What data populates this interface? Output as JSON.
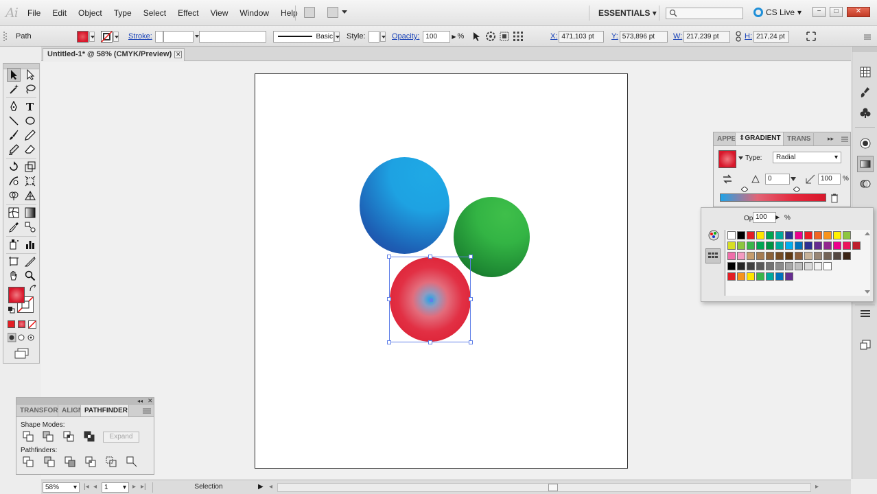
{
  "app": {
    "logo": "Ai"
  },
  "menu": [
    "File",
    "Edit",
    "Object",
    "Type",
    "Select",
    "Effect",
    "View",
    "Window",
    "Help"
  ],
  "header": {
    "workspace": "ESSENTIALS",
    "search_placeholder": "",
    "cs_live": "CS Live",
    "window_minimize": "−",
    "window_restore": "□",
    "window_close": "✕"
  },
  "control_bar": {
    "selection_type": "Path",
    "stroke_label": "Stroke:",
    "brush_label": "Basic",
    "style_label": "Style:",
    "opacity_label": "Opacity:",
    "opacity_value": "100",
    "opacity_unit": "%",
    "x_label": "X:",
    "x_value": "471,103 pt",
    "y_label": "Y:",
    "y_value": "573,896 pt",
    "w_label": "W:",
    "w_value": "217,239 pt",
    "h_label": "H:",
    "h_value": "217,24 pt"
  },
  "document": {
    "tab_title": "Untitled-1* @ 58% (CMYK/Preview)",
    "close_symbol": "✕"
  },
  "artwork": {
    "blue_circle_colors": [
      "#1fa9e5",
      "#2540a0"
    ],
    "green_circle_colors": [
      "#3fbf4a",
      "#0d5a22"
    ],
    "red_circle_colors": [
      "#1ea3e8",
      "#d8172b"
    ],
    "selection_color": "#5f7fe8"
  },
  "gradient_panel": {
    "tabs": [
      "APPEA",
      "GRADIENT",
      "TRANS"
    ],
    "active_tab": "GRADIENT",
    "type_label": "Type:",
    "type_value": "Radial",
    "angle_value": "0",
    "aspect_value": "100",
    "aspect_unit": "%",
    "gradient_colors": [
      "#1ea3e8",
      "#e26576",
      "#d8172b"
    ]
  },
  "swatch_popup": {
    "opacity_label": "Opacity:",
    "opacity_value": "100",
    "opacity_unit": "%",
    "swatch_rows": [
      [
        "#ffffff",
        "#000000",
        "#e31e24",
        "#ffe500",
        "#00a651",
        "#00a99d",
        "#2e3192",
        "#ec008c",
        "#ed1c24",
        "#f26522",
        "#f7941d",
        "#fff200",
        "#8dc63f"
      ],
      [
        "#d7df23",
        "#8cc63f",
        "#39b54a",
        "#00a651",
        "#009444",
        "#00a99d",
        "#00aeef",
        "#0072bc",
        "#2e3192",
        "#662d91",
        "#92278f",
        "#ec008c",
        "#ed145b",
        "#be1e2d"
      ],
      [
        "#f06eaa",
        "#f49ac1",
        "#c69c6d",
        "#a67c52",
        "#8c6239",
        "#754c24",
        "#603913",
        "#8b5e3c",
        "#c7b299",
        "#998675",
        "#736357",
        "#534741",
        "#3c2415"
      ],
      [
        "#000000",
        "#262626",
        "#404040",
        "#595959",
        "#737373",
        "#8c8c8c",
        "#a6a6a6",
        "#bfbfbf",
        "#d9d9d9",
        "#f2f2f2",
        "#ffffff"
      ],
      [
        "#e31e24",
        "#f7941d",
        "#ffe500",
        "#39b54a",
        "#00a99d",
        "#0072bc",
        "#662d91"
      ]
    ]
  },
  "pathfinder_panel": {
    "tabs": [
      "TRANSFORI",
      "ALIGN",
      "PATHFINDER"
    ],
    "active_tab": "PATHFINDER",
    "shape_modes_label": "Shape Modes:",
    "pathfinders_label": "Pathfinders:",
    "expand_label": "Expand"
  },
  "status_bar": {
    "zoom": "58%",
    "artboard_number": "1",
    "tool_name": "Selection"
  }
}
